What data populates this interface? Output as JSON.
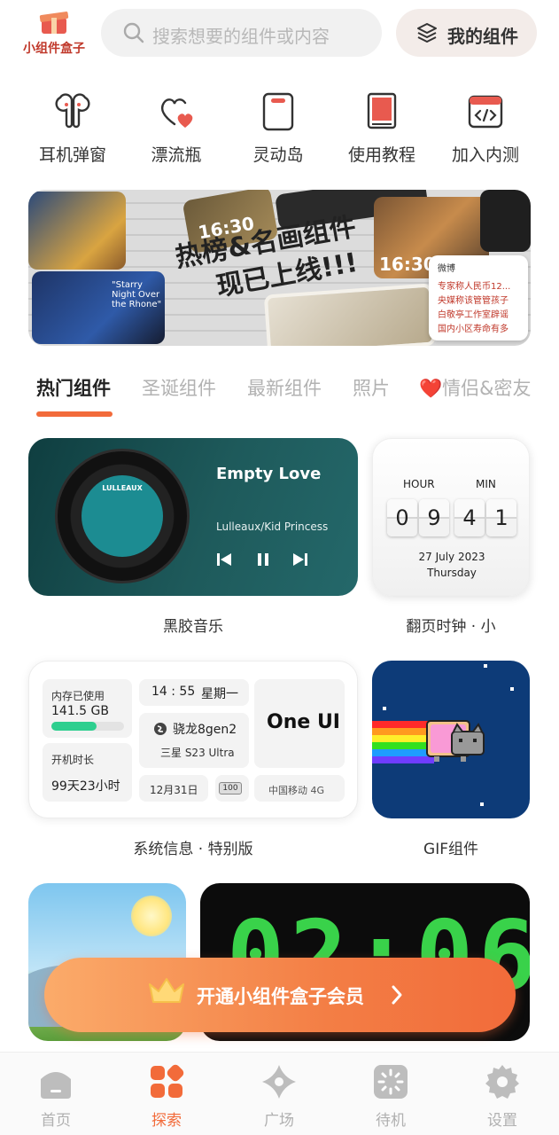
{
  "app": {
    "logo_text": "小组件盒子",
    "search_placeholder": "搜索想要的组件或内容",
    "my_widgets_label": "我的组件"
  },
  "quick_actions": [
    {
      "label": "耳机弹窗",
      "icon": "earbuds-icon"
    },
    {
      "label": "漂流瓶",
      "icon": "hearts-icon"
    },
    {
      "label": "灵动岛",
      "icon": "phone-island-icon"
    },
    {
      "label": "使用教程",
      "icon": "book-icon"
    },
    {
      "label": "加入内测",
      "icon": "code-window-icon"
    }
  ],
  "banner": {
    "title_line1": "热榜&名画组件",
    "title_line2": "现已上线!!!",
    "time_left": "16:30",
    "time_right": "16:30",
    "painting_caption": "\"Starry Night Over the Rhone\"",
    "weibo_label": "微博",
    "weibo_items": [
      "专家称人民币12...",
      "央媒称该管管孩子",
      "白敬亭工作室辟谣",
      "国内小区寿命有多"
    ]
  },
  "tabs": [
    {
      "label": "热门组件",
      "active": true
    },
    {
      "label": "圣诞组件",
      "active": false
    },
    {
      "label": "最新组件",
      "active": false
    },
    {
      "label": "照片",
      "active": false
    },
    {
      "label": "❤️情侣&密友",
      "active": false
    }
  ],
  "widgets": {
    "music": {
      "name": "黑胶音乐",
      "song_title": "Empty Love",
      "artist": "Lulleaux/Kid Princess",
      "album_text": "LULLEAUX"
    },
    "flip_clock": {
      "name": "翻页时钟 · 小",
      "hour_label": "HOUR",
      "min_label": "MIN",
      "digits": [
        "0",
        "9",
        "4",
        "1"
      ],
      "date": "27 July 2023",
      "weekday": "Thursday"
    },
    "system_info": {
      "name": "系统信息 · 特别版",
      "memory_label": "内存已使用",
      "memory_value": "141.5 GB",
      "memory_fraction": 0.62,
      "uptime_label": "开机时长",
      "uptime_value": "99天23小时",
      "time": "14 : 55",
      "weekday": "星期一",
      "chip": "骁龙8gen2",
      "device": "三星 S23 Ultra",
      "date": "12月31日",
      "battery": "100",
      "ui": "One UI",
      "carrier": "中国移动 4G"
    },
    "gif": {
      "name": "GIF组件"
    },
    "digital_clock": {
      "display": "02:06"
    }
  },
  "vip": {
    "label": "开通小组件盒子会员"
  },
  "bottom_nav": [
    {
      "label": "首页",
      "icon": "home-icon",
      "active": false
    },
    {
      "label": "探索",
      "icon": "explore-icon",
      "active": true
    },
    {
      "label": "广场",
      "icon": "plaza-icon",
      "active": false
    },
    {
      "label": "待机",
      "icon": "standby-icon",
      "active": false
    },
    {
      "label": "设置",
      "icon": "settings-icon",
      "active": false
    }
  ],
  "colors": {
    "accent": "#f26b3a",
    "music_bg": "#1e5a5b",
    "gif_bg": "#0d3b78",
    "clock_green": "#39d24a"
  }
}
